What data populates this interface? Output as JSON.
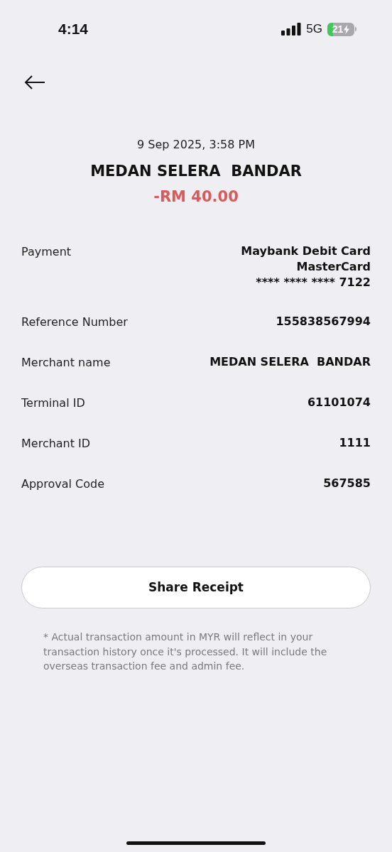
{
  "status_bar": {
    "time": "4:14",
    "network": "5G",
    "battery": "21"
  },
  "header": {
    "date": "9 Sep 2025, 3:58 PM",
    "merchant": "MEDAN SELERA  BANDAR",
    "amount": "-RM 40.00"
  },
  "details": [
    {
      "label": "Payment",
      "value": [
        "Maybank Debit Card",
        "MasterCard",
        "**** **** **** 7122"
      ]
    },
    {
      "label": "Reference Number",
      "value": [
        "155838567994"
      ]
    },
    {
      "label": "Merchant name",
      "value": [
        "MEDAN SELERA  BANDAR"
      ]
    },
    {
      "label": "Terminal ID",
      "value": [
        "61101074"
      ]
    },
    {
      "label": "Merchant ID",
      "value": [
        "1111"
      ]
    },
    {
      "label": "Approval Code",
      "value": [
        "567585"
      ]
    }
  ],
  "share_button": "Share Receipt",
  "note": "* Actual transaction amount in MYR will reflect in your transaction history once it's processed. It will include the overseas transaction fee and admin fee."
}
